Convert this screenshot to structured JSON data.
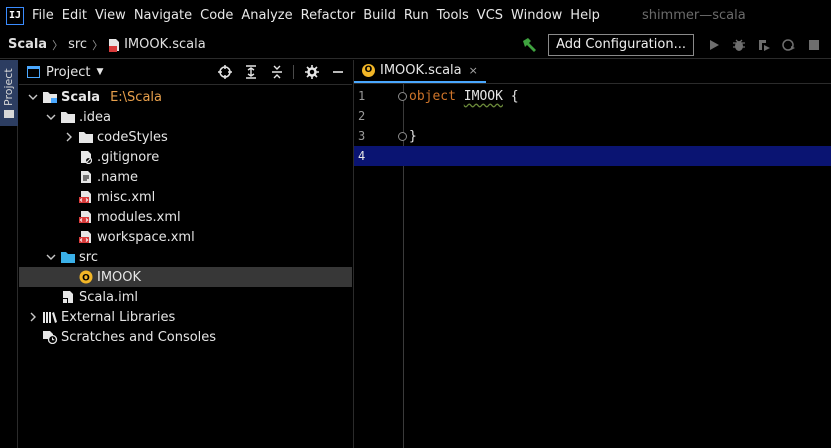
{
  "menubar": {
    "logo_text": "IJ",
    "items": [
      "File",
      "Edit",
      "View",
      "Navigate",
      "Code",
      "Analyze",
      "Refactor",
      "Build",
      "Run",
      "Tools",
      "VCS",
      "Window",
      "Help"
    ],
    "window_title": "shimmer—scala"
  },
  "navbar": {
    "breadcrumb": [
      "Scala",
      "src",
      "IMOOK.scala"
    ],
    "add_configuration_label": "Add Configuration...",
    "toolbar_icons": [
      "run-icon",
      "debug-icon",
      "coverage-icon",
      "profile-icon",
      "stop-icon"
    ]
  },
  "side_strip": {
    "project_tab_label": "Project"
  },
  "project_panel": {
    "title": "Project",
    "tools": [
      "locate-icon",
      "expand-all-icon",
      "collapse-all-icon",
      "settings-icon",
      "hide-icon"
    ],
    "tree": [
      {
        "label": "Scala",
        "path": "E:\\Scala",
        "depth": 0,
        "arrow": "down",
        "icon": "module-folder-icon",
        "bold": true
      },
      {
        "label": ".idea",
        "depth": 1,
        "arrow": "down",
        "icon": "folder-icon"
      },
      {
        "label": "codeStyles",
        "depth": 2,
        "arrow": "right",
        "icon": "folder-icon"
      },
      {
        "label": ".gitignore",
        "depth": 2,
        "arrow": "",
        "icon": "gitignore-file-icon"
      },
      {
        "label": ".name",
        "depth": 2,
        "arrow": "",
        "icon": "text-file-icon"
      },
      {
        "label": "misc.xml",
        "depth": 2,
        "arrow": "",
        "icon": "xml-file-icon"
      },
      {
        "label": "modules.xml",
        "depth": 2,
        "arrow": "",
        "icon": "xml-file-icon"
      },
      {
        "label": "workspace.xml",
        "depth": 2,
        "arrow": "",
        "icon": "xml-file-icon"
      },
      {
        "label": "src",
        "depth": 1,
        "arrow": "down",
        "icon": "source-folder-icon"
      },
      {
        "label": "IMOOK",
        "depth": 2,
        "arrow": "",
        "icon": "scala-object-icon",
        "selected": true
      },
      {
        "label": "Scala.iml",
        "depth": 1,
        "arrow": "",
        "icon": "iml-file-icon"
      },
      {
        "label": "External Libraries",
        "depth": 0,
        "arrow": "right",
        "icon": "libraries-icon"
      },
      {
        "label": "Scratches and Consoles",
        "depth": 0,
        "arrow": "",
        "icon": "scratches-icon"
      }
    ]
  },
  "editor": {
    "tab": {
      "label": "IMOOK.scala",
      "icon_text": "O",
      "close": "×"
    },
    "lines": [
      {
        "num": "1",
        "keyword": "object",
        "name": "IMOOK",
        "rest": " {",
        "fold": true
      },
      {
        "num": "2",
        "keyword": "",
        "name": "",
        "rest": "",
        "fold": false
      },
      {
        "num": "3",
        "keyword": "",
        "name": "",
        "rest": "}",
        "fold": true
      },
      {
        "num": "4",
        "keyword": "",
        "name": "",
        "rest": "",
        "fold": false,
        "current": true
      }
    ]
  },
  "colors": {
    "background": "#000000",
    "selection": "#373737",
    "current_line": "#0a1472",
    "keyword": "#d0752a",
    "accent": "#4aa8ff",
    "path": "#e8a04c",
    "scala_object": "#f2b627",
    "run_green": "#3fa33f"
  }
}
